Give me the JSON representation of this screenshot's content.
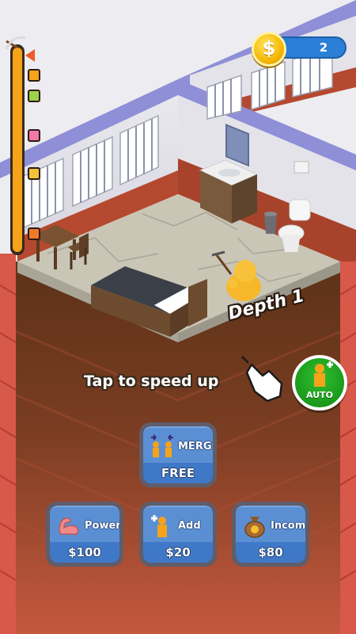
{
  "hud": {
    "coins": "2",
    "coin_symbol": "$",
    "depth_markers": [
      "crate",
      "crate",
      "crate",
      "crate",
      "crate"
    ]
  },
  "scene": {
    "depth_label": "Depth 1",
    "tap_hint": "Tap to speed up"
  },
  "auto_button": {
    "label": "AUTO",
    "icon": "worker-plus-icon"
  },
  "upgrades": {
    "merge": {
      "label": "MERGE",
      "price": "FREE",
      "icon": "merge-workers-icon"
    },
    "power": {
      "label": "Power",
      "price": "$100",
      "icon": "flexed-arm-icon"
    },
    "add": {
      "label": "Add",
      "price": "$20",
      "icon": "add-worker-icon"
    },
    "income": {
      "label": "Income",
      "price": "$80",
      "icon": "money-bag-icon"
    }
  },
  "colors": {
    "wall_purple": "#8e8fd6",
    "floor": "#c9c6b6",
    "dirt": "#6d3d1e",
    "button_blue": "#3f78c7",
    "auto_green": "#1fa21f",
    "progress_orange": "#f5a31a"
  }
}
